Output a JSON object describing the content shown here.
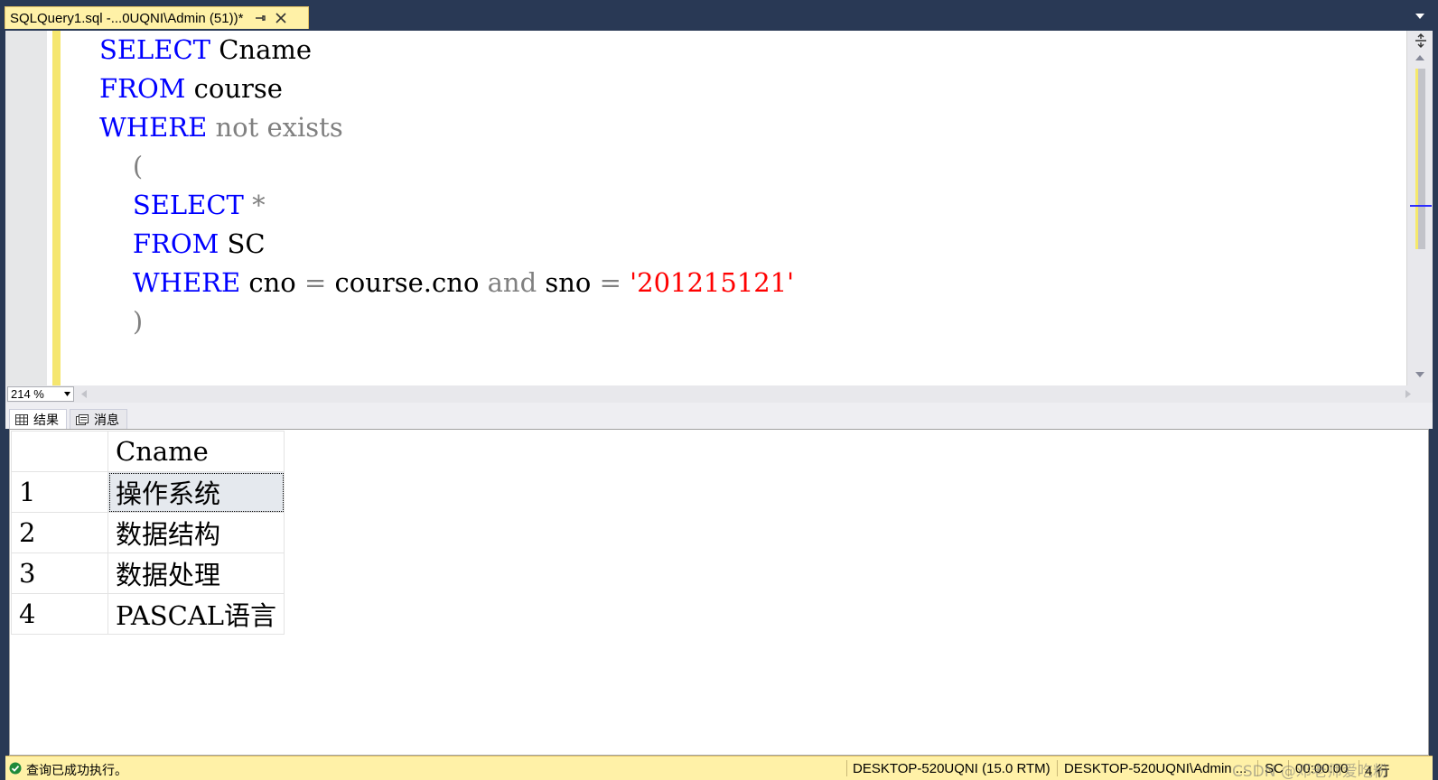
{
  "tab": {
    "title": "SQLQuery1.sql -...0UQNI\\Admin (51))*"
  },
  "editor": {
    "lines": [
      [
        {
          "t": "SELECT",
          "c": "kw"
        },
        {
          "t": " Cname",
          "c": ""
        }
      ],
      [
        {
          "t": "FROM",
          "c": "kw"
        },
        {
          "t": " course",
          "c": ""
        }
      ],
      [
        {
          "t": "WHERE",
          "c": "kw"
        },
        {
          "t": " not exists",
          "c": "op"
        }
      ],
      [
        {
          "t": "    (",
          "c": "op"
        }
      ],
      [
        {
          "t": "    ",
          "c": ""
        },
        {
          "t": "SELECT",
          "c": "kw"
        },
        {
          "t": " *",
          "c": "op"
        }
      ],
      [
        {
          "t": "    ",
          "c": ""
        },
        {
          "t": "FROM",
          "c": "kw"
        },
        {
          "t": " SC",
          "c": ""
        }
      ],
      [
        {
          "t": "    ",
          "c": ""
        },
        {
          "t": "WHERE",
          "c": "kw"
        },
        {
          "t": " cno ",
          "c": ""
        },
        {
          "t": "=",
          "c": "op"
        },
        {
          "t": " course.cno ",
          "c": ""
        },
        {
          "t": "and",
          "c": "op"
        },
        {
          "t": " sno ",
          "c": ""
        },
        {
          "t": "=",
          "c": "op"
        },
        {
          "t": " ",
          "c": ""
        },
        {
          "t": "'201215121'",
          "c": "str"
        }
      ],
      [
        {
          "t": "    )",
          "c": "op"
        }
      ]
    ]
  },
  "zoom": {
    "value": "214 %"
  },
  "results_tabs": {
    "results": "结果",
    "messages": "消息"
  },
  "grid": {
    "column": "Cname",
    "rows": [
      {
        "num": "1",
        "name": "操作系统"
      },
      {
        "num": "2",
        "name": "数据结构"
      },
      {
        "num": "3",
        "name": "数据处理"
      },
      {
        "num": "4",
        "name": "PASCAL语言"
      }
    ]
  },
  "status": {
    "message": "查询已成功执行。",
    "server": "DESKTOP-520UQNI (15.0 RTM)",
    "user": "DESKTOP-520UQNI\\Admin ...",
    "database": "SC",
    "elapsed": "00:00:00",
    "rows": "4 行"
  },
  "watermark": "CSDN @邓老师爱吃粉",
  "colors": {
    "keyword": "#0000ff",
    "operator": "#808080",
    "string": "#ff0000",
    "status_bar": "#fff1a7",
    "chrome": "#293955"
  },
  "icons": [
    "pin-icon",
    "close-icon",
    "split-icon",
    "grid-icon",
    "messages-icon",
    "success-icon"
  ]
}
